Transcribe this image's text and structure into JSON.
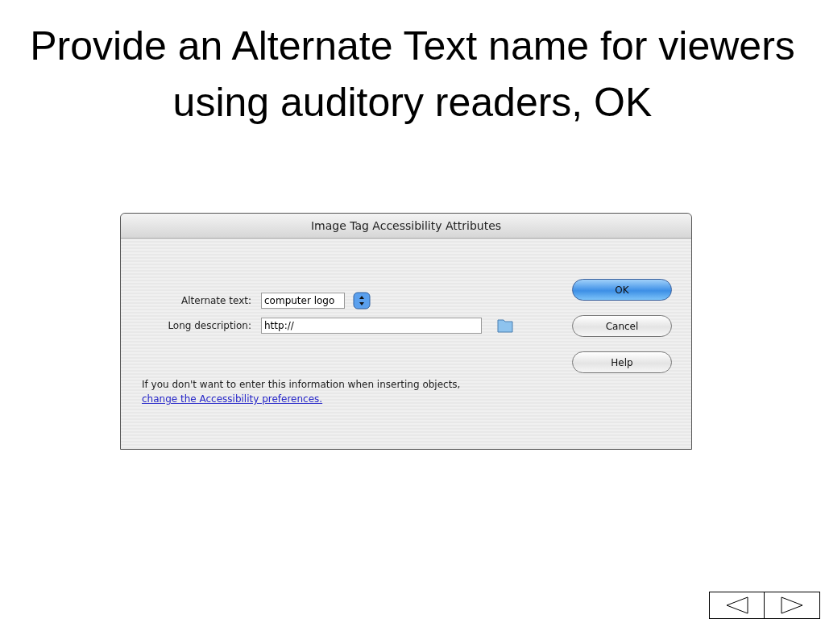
{
  "slide": {
    "title": "Provide an Alternate Text name for viewers using auditory readers, OK"
  },
  "dialog": {
    "title": "Image Tag Accessibility Attributes",
    "fields": [
      {
        "label": "Alternate text:",
        "value": "computer logo",
        "kind": "combo"
      },
      {
        "label": "Long description:",
        "value": "http://",
        "kind": "browse"
      }
    ],
    "buttons": [
      {
        "label": "OK",
        "default": true
      },
      {
        "label": "Cancel",
        "default": false
      },
      {
        "label": "Help",
        "default": false
      }
    ],
    "note": {
      "text": "If you don't want to enter this information when inserting objects,",
      "link": "change the Accessibility preferences."
    }
  }
}
